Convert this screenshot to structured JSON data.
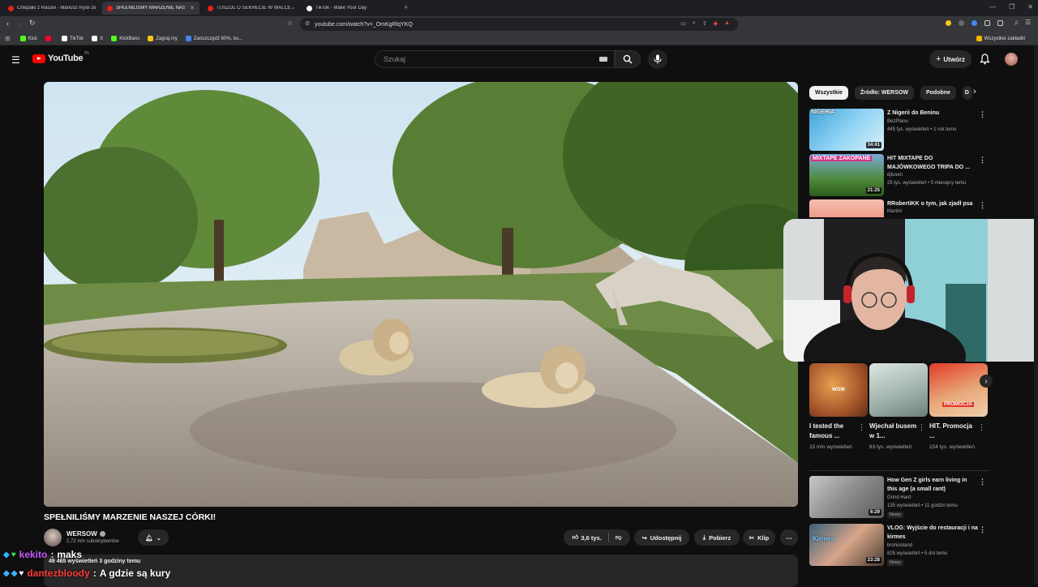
{
  "browser": {
    "tabs": [
      {
        "label": "Chlopaki z Raszei - Mariusz myśli że",
        "active": false,
        "color": "#e62117"
      },
      {
        "label": "SPEŁNILIŚMY MARZENIE NASZ",
        "active": true,
        "color": "#e62117"
      },
      {
        "label": "TUSZOL O SEKRECIE W WALCE Z N...",
        "active": false,
        "color": "#e62117"
      },
      {
        "label": "TikTok - Make Your Day",
        "active": false,
        "color": "#ffffff"
      }
    ],
    "url": "youtube.com/watch?v=_OmKgRlqYKQ",
    "bookmarks": [
      {
        "label": "Kick",
        "color": "#53fc18"
      },
      {
        "label": "",
        "color": "#ff0033"
      },
      {
        "label": "TikTok",
        "color": "#ffffff"
      },
      {
        "label": "X",
        "color": "#ffffff"
      },
      {
        "label": "KickBans",
        "color": "#53fc18"
      },
      {
        "label": "Zagraj.my",
        "color": "#f5c518"
      },
      {
        "label": "Zaoszczędź 60%, ku...",
        "color": "#4285f4"
      }
    ],
    "bookmarks_all": "Wszystkie zakładki"
  },
  "header": {
    "logo_text": "YouTube",
    "logo_region": "PL",
    "search_placeholder": "Szukaj",
    "create_label": "Utwórz"
  },
  "video": {
    "title": "SPEŁNILIŚMY MARZENIE NASZEJ CÓRKI!",
    "channel": "WERSOW",
    "subscribers": "2,72 mln subskrybentów",
    "likes": "3,6 tys.",
    "share_label": "Udostępnij",
    "download_label": "Pobierz",
    "clip_label": "Klip",
    "views_meta": "49 465 wyświetleń  3 godziny temu"
  },
  "sidebar": {
    "chips": [
      "Wszystkie",
      "Źródło: WERSOW",
      "Podobne",
      "D"
    ],
    "recs": [
      {
        "title": "Z Nigerii do Beninu",
        "channel": "BezPlanu",
        "meta": "445 tys. wyświetleń • 1 rok temu",
        "duration": "34:41",
        "thumb_text": "NIGERIA",
        "badge": ""
      },
      {
        "title": "HIT MIXTAPE DO MAJÓWKOWEGO TRIPA DO ...",
        "channel": "djlusen",
        "meta": "25 tys. wyświetleń • 5 miesięcy temu",
        "duration": "21:25",
        "thumb_text": "MIXTAPE ZAKOPANE",
        "badge": ""
      },
      {
        "title": "RRobertiKK o tym, jak zjadł psa",
        "channel": "Martini",
        "meta": "",
        "duration": "",
        "thumb_text": "",
        "badge": ""
      },
      {
        "title": "How Gen Z girls earn living in this age (a small rant)",
        "channel": "Grind Hard",
        "meta": "135 wyświetleń • 11 godzin temu",
        "duration": "6:29",
        "thumb_text": "",
        "badge": "Nowy"
      },
      {
        "title": "VLOG: Wyjście do restauracji i na kirmes",
        "channel": "bronisoland",
        "meta": "825 wyświetleń • 5 dni temu",
        "duration": "23:28",
        "thumb_text": "Kirmes",
        "badge": "Nowy"
      }
    ],
    "shorts": [
      {
        "title": "I tested the famous ...",
        "meta": "15 mln wyświetleń",
        "thumb_text": "WOW"
      },
      {
        "title": "Wjechał busem w 1...",
        "meta": "83 tys. wyświetleń",
        "thumb_text": ""
      },
      {
        "title": "HIT. Promocja ...",
        "meta": "154 tys. wyświetleń",
        "thumb_text": "PROMOCJA"
      }
    ]
  },
  "chat": [
    {
      "user": "kekito",
      "message": "maks",
      "user_color": "#c45bff"
    },
    {
      "user": "dantezbloody",
      "message": "A gdzie są kury",
      "user_color": "#ff3b3b"
    }
  ]
}
